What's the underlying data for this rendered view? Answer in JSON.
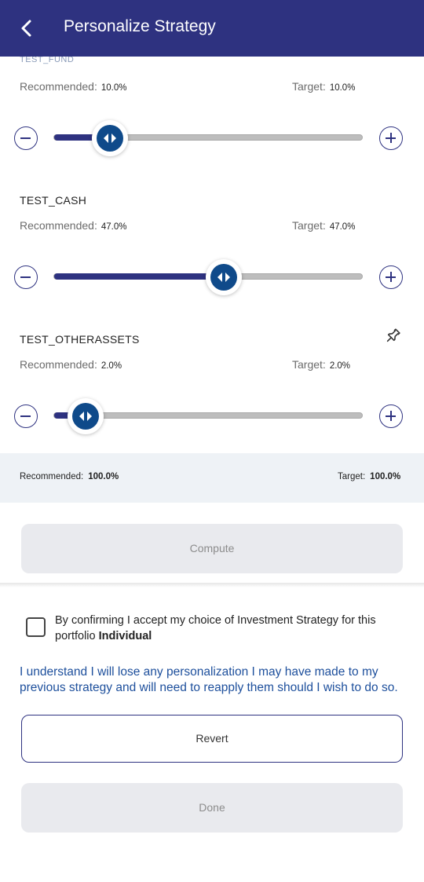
{
  "header": {
    "title": "Personalize Strategy",
    "back_icon": "chevron-left-icon"
  },
  "cut_off_fund": {
    "name": "TEST_FUND"
  },
  "labels": {
    "recommended": "Recommended:",
    "target": "Target:"
  },
  "funds": [
    {
      "name": "",
      "recommended": "10.0%",
      "target": "10.0%",
      "slider_percent": 10
    },
    {
      "name": "TEST_CASH",
      "recommended": "47.0%",
      "target": "47.0%",
      "slider_percent": 47
    },
    {
      "name": "TEST_OTHERASSETS",
      "recommended": "2.0%",
      "target": "2.0%",
      "slider_percent": 2,
      "pinned_icon": "pin-icon"
    }
  ],
  "summary": {
    "recommended": "100.0%",
    "target": "100.0%"
  },
  "compute_label": "Compute",
  "confirm": {
    "text": "By confirming I accept my choice of Investment Strategy for this portfolio",
    "portfolio": "Individual",
    "checked": false
  },
  "notice": "I understand I will lose any personalization I may have made to my previous strategy and will need to reapply them should I wish to do so.",
  "revert_label": "Revert",
  "done_label": "Done",
  "colors": {
    "header_bg": "#2e3280",
    "accent": "#2e3280",
    "thumb": "#0f4a8a",
    "notice_text": "#1d4f9c",
    "summary_bg": "#eef2f6"
  }
}
